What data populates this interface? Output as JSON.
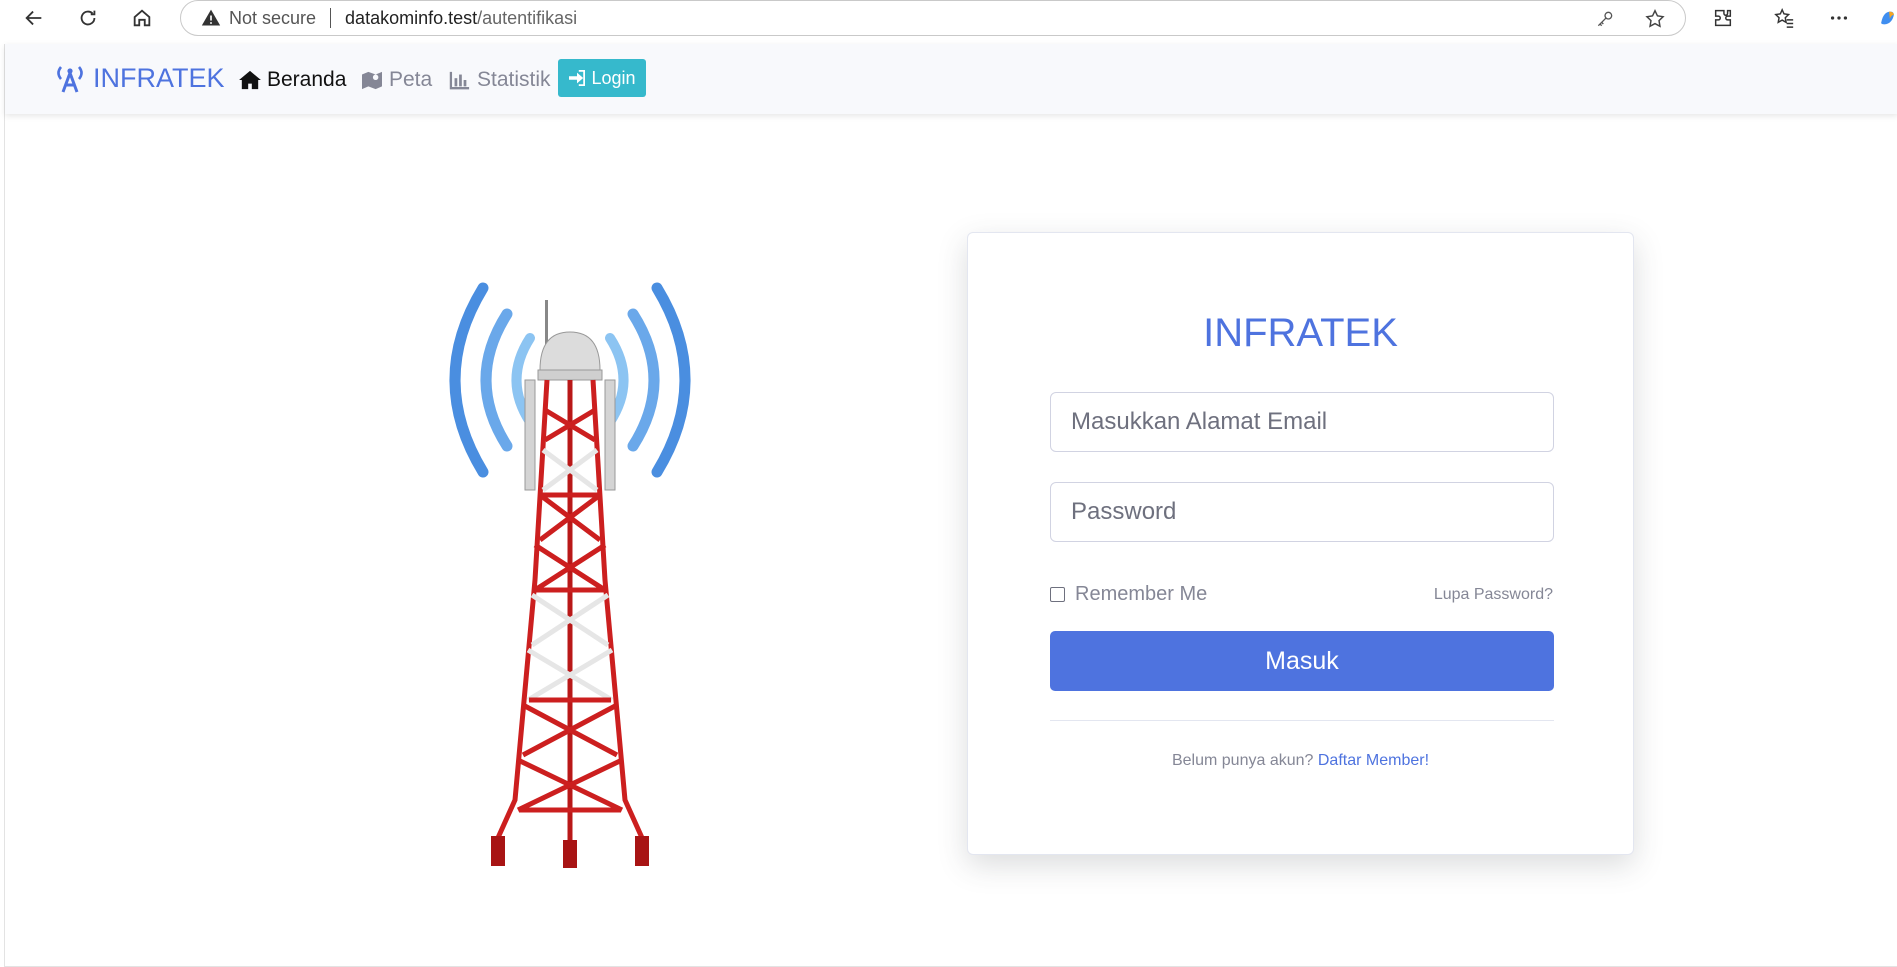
{
  "browser": {
    "not_secure": "Not secure",
    "url_host": "datakominfo.test",
    "url_path": "/autentifikasi"
  },
  "navbar": {
    "brand": "INFRATEK",
    "items": [
      {
        "label": "Beranda",
        "icon": "home-icon",
        "active": true
      },
      {
        "label": "Peta",
        "icon": "map-icon",
        "active": false
      },
      {
        "label": "Statistik",
        "icon": "chart-icon",
        "active": false
      }
    ],
    "login_label": "Login"
  },
  "login_card": {
    "title": "INFRATEK",
    "email_placeholder": "Masukkan Alamat Email",
    "password_placeholder": "Password",
    "remember_label": "Remember Me",
    "forgot_label": "Lupa Password?",
    "submit_label": "Masuk",
    "register_prompt": "Belum punya akun?",
    "register_link": "Daftar Member!"
  },
  "colors": {
    "primary": "#4e73df",
    "info": "#36b9cc",
    "muted": "#858796"
  }
}
